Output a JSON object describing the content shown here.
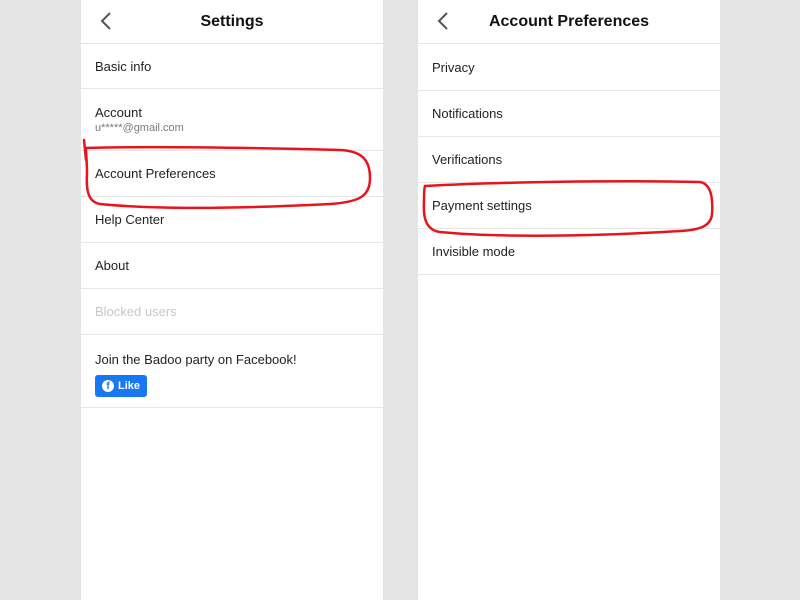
{
  "left": {
    "title": "Settings",
    "rows": {
      "basic_info": "Basic info",
      "account": "Account",
      "account_email": "u*****@gmail.com",
      "account_preferences": "Account Preferences",
      "help_center": "Help Center",
      "about": "About",
      "blocked_users": "Blocked users"
    },
    "facebook": {
      "text": "Join the Badoo party on Facebook!",
      "like_label": "Like"
    }
  },
  "right": {
    "title": "Account Preferences",
    "rows": {
      "privacy": "Privacy",
      "notifications": "Notifications",
      "verifications": "Verifications",
      "payment_settings": "Payment settings",
      "invisible_mode": "Invisible mode"
    }
  },
  "colors": {
    "background": "#e4e4e4",
    "panel": "#ffffff",
    "divider": "#e6e6e6",
    "facebook_blue": "#1877f2",
    "highlight_red": "#e8141c",
    "disabled_text": "#c7c7c7"
  },
  "icons": {
    "back": "chevron-left-icon",
    "facebook": "facebook-icon"
  }
}
